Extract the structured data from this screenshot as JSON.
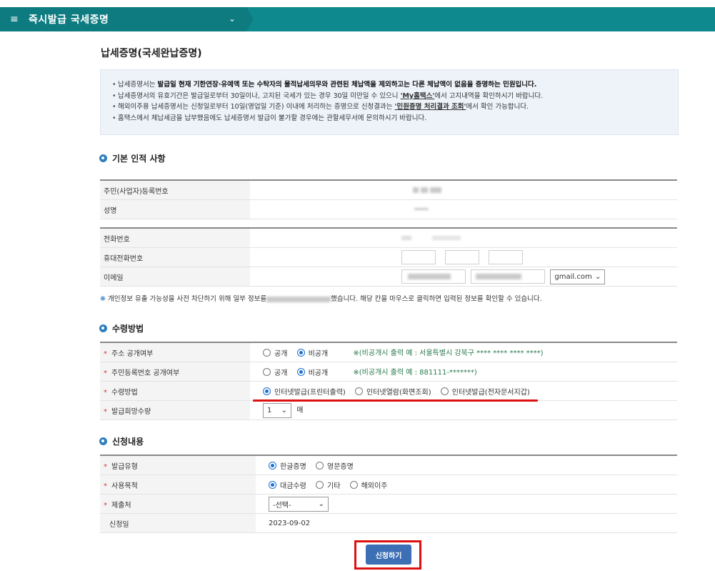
{
  "topbar": {
    "menu_icon": "≡",
    "title": "즉시발급 국세증명",
    "chevron": "⌄"
  },
  "page_title": "납세증명(국세완납증명)",
  "notice": [
    {
      "pre": "납세증명서는 ",
      "bold": "발급일 현재 기한연장·유예액 또는 수탁자의 물적납세의무와 관련된 체납액을 제외하고는 다른 체납액이 없음을 증명하는 민원입니다.",
      "post": ""
    },
    {
      "pre": "납세증명서의 유효기간은 발급일로부터 30일이나, 고지된 국세가 있는 경우 30일 미만일 수 있으니 ",
      "bold": "'My홈택스'",
      "post": "에서 고지내역을 확인하시기 바랍니다."
    },
    {
      "pre": "해외이주용 납세증명서는 신청일로부터 10일(영업일 기준) 이내에 처리하는 증명으로 신청결과는 ",
      "bold": "'민원증명 처리결과 조회'",
      "post": "에서 확인 가능합니다."
    },
    {
      "pre": "홈택스에서 체납세금을 납부했음에도 납세증명서 발급이 불가할 경우에는 관할세무서에 문의하시기 바랍니다.",
      "bold": "",
      "post": ""
    }
  ],
  "sections": {
    "basic": "기본 인적 사항",
    "receive": "수령방법",
    "apply": "신청내용"
  },
  "basic": {
    "rrn_label": "주민(사업자)등록번호",
    "name_label": "성명",
    "phone_label": "전화번호",
    "mobile_label": "휴대전화번호",
    "email_label": "이메일",
    "email_domain": "gmail.com"
  },
  "hint": "개인정보 유출 가능성을 사전 차단하기 위해 일부 정보를",
  "hint2": "했습니다. 해당 칸을 마우스로 클릭하면 입력된 정보를 확인할 수 있습니다.",
  "receive": {
    "addr_label": "주소 공개여부",
    "addr_open": "공개",
    "addr_closed": "비공개",
    "addr_note": "※(비공개시 출력 예 : 서울특별시 강북구 **** **** **** ****)",
    "rrn_label": "주민등록번호 공개여부",
    "rrn_open": "공개",
    "rrn_closed": "비공개",
    "rrn_note": "※(비공개시 출력 예 : 881111-*******)",
    "method_label": "수령방법",
    "method_opt1": "인터넷발급(프린터출력)",
    "method_opt2": "인터넷열람(화면조회)",
    "method_opt3": "인터넷발급(전자문서지갑)",
    "qty_label": "발급희망수량",
    "qty_value": "1",
    "qty_unit": "매"
  },
  "apply": {
    "type_label": "발급유형",
    "type_opt1": "한글증명",
    "type_opt2": "영문증명",
    "purpose_label": "사용목적",
    "purpose_opt1": "대금수령",
    "purpose_opt2": "기타",
    "purpose_opt3": "해외이주",
    "submit_to_label": "제출처",
    "submit_to_value": "-선택-",
    "date_label": "신청일",
    "date_value": "2023-09-02"
  },
  "submit_label": "신청하기"
}
